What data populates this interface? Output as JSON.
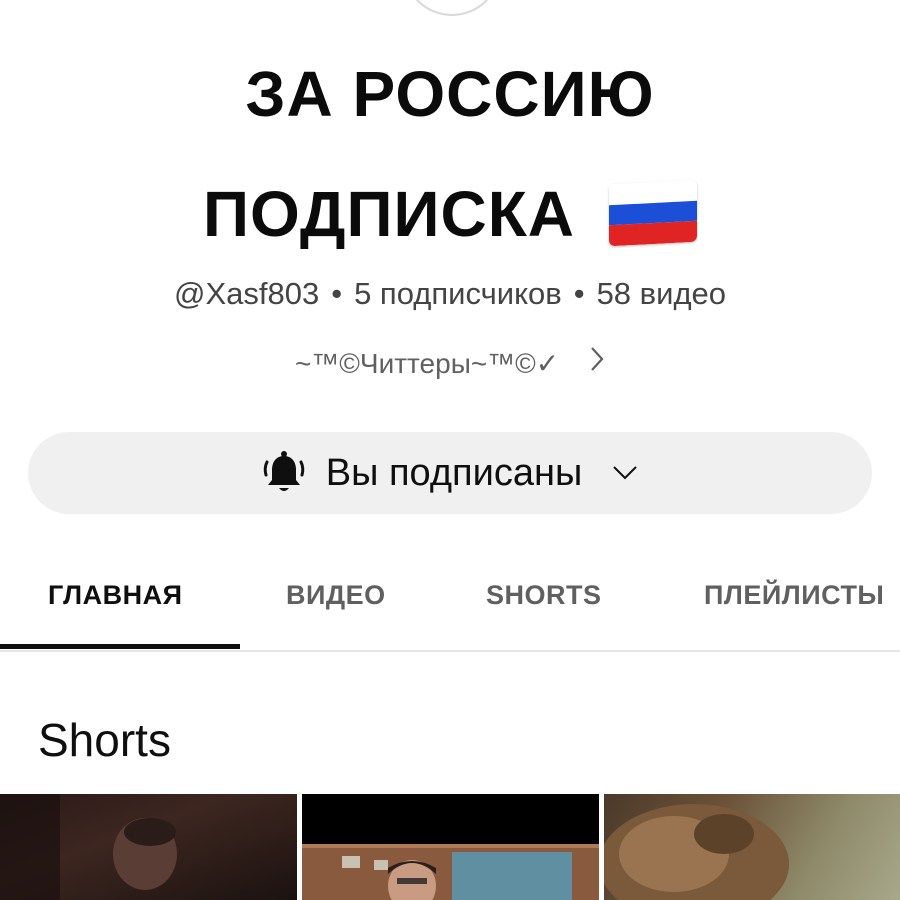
{
  "channel": {
    "title_line1": "ЗА РОССИЮ",
    "title_line2": "ПОДПИСКА",
    "flag_icon": "russian-flag-icon",
    "flag_colors": [
      "#ffffff",
      "#1c4fd8",
      "#e02424"
    ],
    "handle": "@Xasf803",
    "subscribers": "5 подписчиков",
    "video_count": "58 видео",
    "separator": "•",
    "links_text": "~™©Читтеры~™©✓"
  },
  "subscribe_button": {
    "label": "Вы подписаны",
    "icon": "bell-ringing-icon"
  },
  "tabs": [
    {
      "label": "ГЛАВНАЯ",
      "active": true
    },
    {
      "label": "ВИДЕО",
      "active": false
    },
    {
      "label": "SHORTS",
      "active": false
    },
    {
      "label": "ПЛЕЙЛИСТЫ",
      "active": false
    }
  ],
  "section": {
    "title": "Shorts"
  }
}
